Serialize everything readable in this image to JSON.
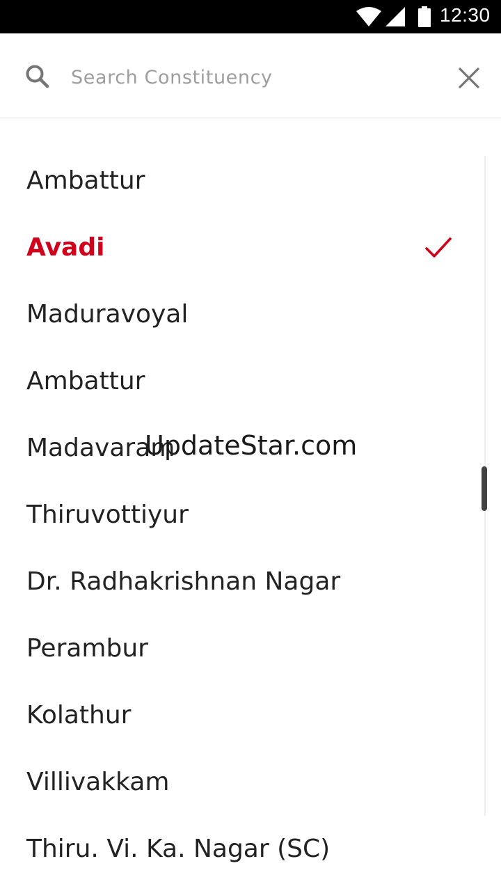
{
  "status_bar": {
    "time": "12:30",
    "icons": [
      "wifi-icon",
      "signal-icon",
      "battery-icon"
    ]
  },
  "search": {
    "placeholder": "Search Constituency",
    "value": "",
    "search_icon": "search-icon",
    "close_icon": "close-icon"
  },
  "list": {
    "items": [
      {
        "label": "Ambattur",
        "selected": false
      },
      {
        "label": "Avadi",
        "selected": true
      },
      {
        "label": "Maduravoyal",
        "selected": false
      },
      {
        "label": "Ambattur",
        "selected": false
      },
      {
        "label": "Madavaram",
        "selected": false
      },
      {
        "label": "Thiruvottiyur",
        "selected": false
      },
      {
        "label": "Dr. Radhakrishnan Nagar",
        "selected": false
      },
      {
        "label": "Perambur",
        "selected": false
      },
      {
        "label": "Kolathur",
        "selected": false
      },
      {
        "label": "Villivakkam",
        "selected": false
      },
      {
        "label": "Thiru. Vi. Ka. Nagar (SC)",
        "selected": false
      }
    ],
    "selected_icon": "check-icon"
  },
  "watermark": "UpdateStar.com",
  "colors": {
    "accent": "#d0021b",
    "text": "#222222",
    "placeholder": "#9e9e9e",
    "status_bar": "#000000"
  }
}
